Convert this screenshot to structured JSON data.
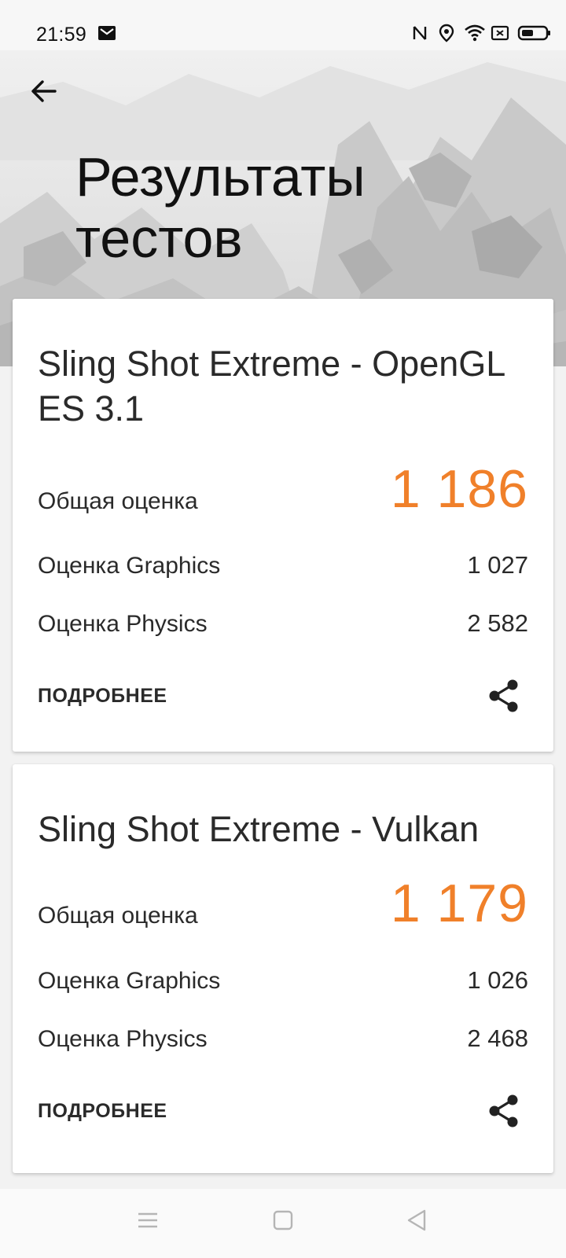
{
  "status_bar": {
    "time": "21:59",
    "icons": [
      "mail-icon",
      "nfc-icon",
      "location-icon",
      "wifi-icon",
      "sim-icon",
      "battery-icon"
    ]
  },
  "header": {
    "title": "Результаты тестов",
    "back_icon": "arrow-left-icon"
  },
  "results": [
    {
      "name": "Sling Shot Extreme - OpenGL ES 3.1",
      "overall_label": "Общая оценка",
      "overall_value": "1 186",
      "graphics_label": "Оценка Graphics",
      "graphics_value": "1 027",
      "physics_label": "Оценка Physics",
      "physics_value": "2 582",
      "details_label": "ПОДРОБНЕЕ",
      "share_icon": "share-icon"
    },
    {
      "name": "Sling Shot Extreme - Vulkan",
      "overall_label": "Общая оценка",
      "overall_value": "1 179",
      "graphics_label": "Оценка Graphics",
      "graphics_value": "1 026",
      "physics_label": "Оценка Physics",
      "physics_value": "2 468",
      "details_label": "ПОДРОБНЕЕ",
      "share_icon": "share-icon"
    }
  ],
  "nav_bar": {
    "buttons": [
      "menu-icon",
      "home-icon",
      "back-triangle-icon"
    ]
  },
  "colors": {
    "accent": "#f0802a",
    "text": "#2a2a2a",
    "card": "#ffffff",
    "background": "#f2f2f2"
  }
}
